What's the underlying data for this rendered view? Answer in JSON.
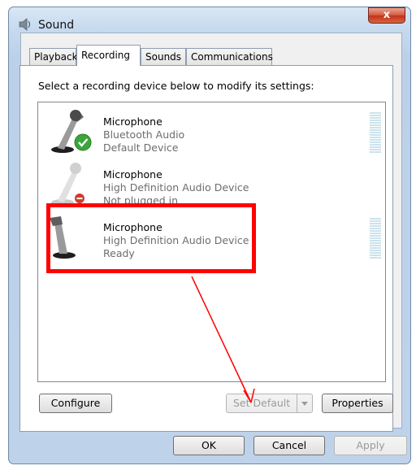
{
  "window": {
    "title": "Sound",
    "close_label": "x"
  },
  "tabs": [
    {
      "label": "Playback"
    },
    {
      "label": "Recording"
    },
    {
      "label": "Sounds"
    },
    {
      "label": "Communications"
    }
  ],
  "instruction": "Select a recording device below to modify its settings:",
  "devices": [
    {
      "name": "Microphone",
      "subtitle": "Bluetooth Audio",
      "status": "Default Device"
    },
    {
      "name": "Microphone",
      "subtitle": "High Definition Audio Device",
      "status": "Not plugged in"
    },
    {
      "name": "Microphone",
      "subtitle": "High Definition Audio Device",
      "status": "Ready"
    }
  ],
  "buttons": {
    "configure": "Configure",
    "set_default": "Set Default",
    "properties": "Properties",
    "ok": "OK",
    "cancel": "Cancel",
    "apply": "Apply"
  },
  "colors": {
    "highlight": "#ff0000",
    "arrow": "#ff0000",
    "default_check": "#3aa53a",
    "unplugged_badge": "#d23a2a"
  }
}
